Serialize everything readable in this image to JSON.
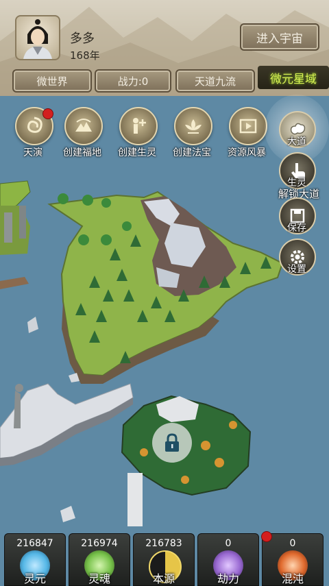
{
  "player": {
    "name": "多多",
    "age": "168年"
  },
  "header": {
    "enter_universe": "进入宇宙"
  },
  "tabs": [
    {
      "label": "微世界"
    },
    {
      "label": "战力:0"
    },
    {
      "label": "天道九流"
    },
    {
      "label": "微元星域",
      "active": true
    }
  ],
  "skills": [
    {
      "label": "天演",
      "icon": "swirl-icon",
      "badge": true
    },
    {
      "label": "创建福地",
      "icon": "mountain-icon"
    },
    {
      "label": "创建生灵",
      "icon": "person-plus-icon"
    },
    {
      "label": "创建法宝",
      "icon": "lotus-icon"
    },
    {
      "label": "资源风暴",
      "icon": "film-icon"
    }
  ],
  "side": [
    {
      "label": "大道",
      "icon": "cloud-swirl-icon"
    },
    {
      "label": "生灵",
      "icon": "hand-pointer-icon"
    },
    {
      "label": "保存",
      "icon": "save-icon"
    },
    {
      "label": "设置",
      "icon": "gear-icon"
    }
  ],
  "unlock_hint": "解锁大道",
  "resources": [
    {
      "value": "216847",
      "label": "灵元",
      "color": "#55b7e6",
      "badge": false
    },
    {
      "value": "216974",
      "label": "灵魂",
      "color": "#78c24b",
      "badge": false
    },
    {
      "value": "216783",
      "label": "本源",
      "color": "#e6c548",
      "badge": false
    },
    {
      "value": "0",
      "label": "劫力",
      "color": "#9a6ad2",
      "badge": false
    },
    {
      "value": "0",
      "label": "混沌",
      "color": "#e06a2e",
      "badge": true
    }
  ],
  "colors": {
    "ocean": "#5f8aa5",
    "accent_tab": "#d6ef53",
    "badge": "#d31f1f"
  }
}
